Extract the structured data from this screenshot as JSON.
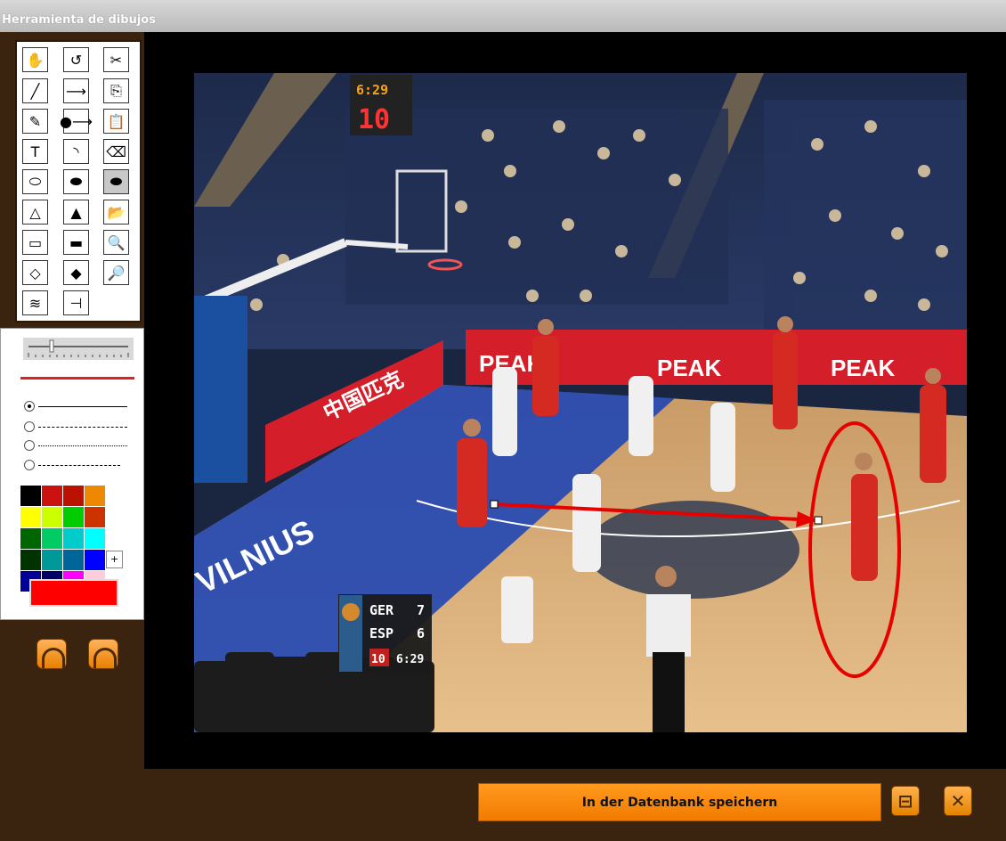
{
  "window": {
    "title": "Herramienta de dibujos"
  },
  "tools": [
    {
      "name": "hand-tool",
      "glyph": "✋"
    },
    {
      "name": "undo-tool",
      "glyph": "↺"
    },
    {
      "name": "cut-tool",
      "glyph": "✂"
    },
    {
      "name": "line-tool",
      "glyph": "╱"
    },
    {
      "name": "arrow-tool",
      "glyph": "⟶"
    },
    {
      "name": "copy-tool",
      "glyph": "⎘"
    },
    {
      "name": "pencil-tool",
      "glyph": "✎"
    },
    {
      "name": "dot-arrow-tool",
      "glyph": "●⟶"
    },
    {
      "name": "paste-tool",
      "glyph": "📋"
    },
    {
      "name": "text-tool",
      "glyph": "T"
    },
    {
      "name": "curve-tool",
      "glyph": "◝"
    },
    {
      "name": "eraser-tool",
      "glyph": "⌫"
    },
    {
      "name": "ellipse-outline-tool",
      "glyph": "⬭"
    },
    {
      "name": "ellipse-filled-tool",
      "glyph": "⬬"
    },
    {
      "name": "ellipse-selected-tool",
      "glyph": "⬬"
    },
    {
      "name": "triangle-outline-tool",
      "glyph": "△"
    },
    {
      "name": "triangle-filled-tool",
      "glyph": "▲"
    },
    {
      "name": "open-folder-tool",
      "glyph": "📂"
    },
    {
      "name": "rect-outline-tool",
      "glyph": "▭"
    },
    {
      "name": "rect-filled-tool",
      "glyph": "▬"
    },
    {
      "name": "zoom-in-tool",
      "glyph": "🔍"
    },
    {
      "name": "diamond-outline-tool",
      "glyph": "◇"
    },
    {
      "name": "diamond-filled-tool",
      "glyph": "◆"
    },
    {
      "name": "zoom-out-tool",
      "glyph": "🔎"
    },
    {
      "name": "zigzag-tool",
      "glyph": "≋"
    },
    {
      "name": "screen-tool",
      "glyph": "⊣"
    }
  ],
  "colors": {
    "palette": [
      "#000000",
      "#cc1111",
      "#bb1100",
      "#ee8800",
      "#ffff00",
      "#ccff00",
      "#00cc00",
      "#cc3300",
      "#006600",
      "#00cc66",
      "#00cccc",
      "#00ffff",
      "#003300",
      "#009999",
      "#006699",
      "#0000ff",
      "#000099",
      "#000066",
      "#ff00ff",
      "#ffccdd"
    ],
    "current": "#ff0000"
  },
  "scoreboard": {
    "team1": "GER",
    "score1": "7",
    "team2": "ESP",
    "score2": "6",
    "period": "10",
    "clock": "6:29",
    "shot_clock_top": "6:29",
    "shot_clock_bottom": "10"
  },
  "arena": {
    "sponsor": "PEAK",
    "court_text": "VILNIUS",
    "cn_text": "中国匹克"
  },
  "footer": {
    "save_label": "In der Datenbank speichern"
  }
}
